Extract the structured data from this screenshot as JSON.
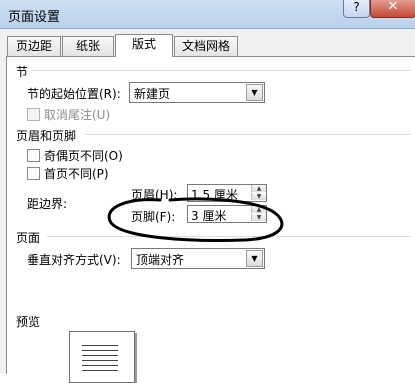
{
  "window": {
    "title": "页面设置",
    "help_label": "?",
    "close_label": "✕"
  },
  "tabs": [
    {
      "label": "页边距",
      "active": false
    },
    {
      "label": "纸张",
      "active": false
    },
    {
      "label": "版式",
      "active": true
    },
    {
      "label": "文档网格",
      "active": false
    }
  ],
  "section": {
    "heading": "节",
    "start_label": "节的起始位置(R):",
    "start_value": "新建页",
    "suppress_endnotes_label": "取消尾注(U)"
  },
  "header_footer": {
    "heading": "页眉和页脚",
    "odd_even_label": "奇偶页不同(O)",
    "first_page_label": "首页不同(P)",
    "from_edge_label": "距边界:",
    "header_label": "页眉(H):",
    "header_value": "1.5 厘米",
    "footer_label": "页脚(F):",
    "footer_value": "3 厘米"
  },
  "page": {
    "heading": "页面",
    "valign_label": "垂直对齐方式(V):",
    "valign_value": "顶端对齐"
  },
  "preview": {
    "heading": "预览"
  },
  "icons": {
    "dropdown": "chevron-down-icon",
    "spin_up": "triangle-up-icon",
    "spin_down": "triangle-down-icon"
  }
}
